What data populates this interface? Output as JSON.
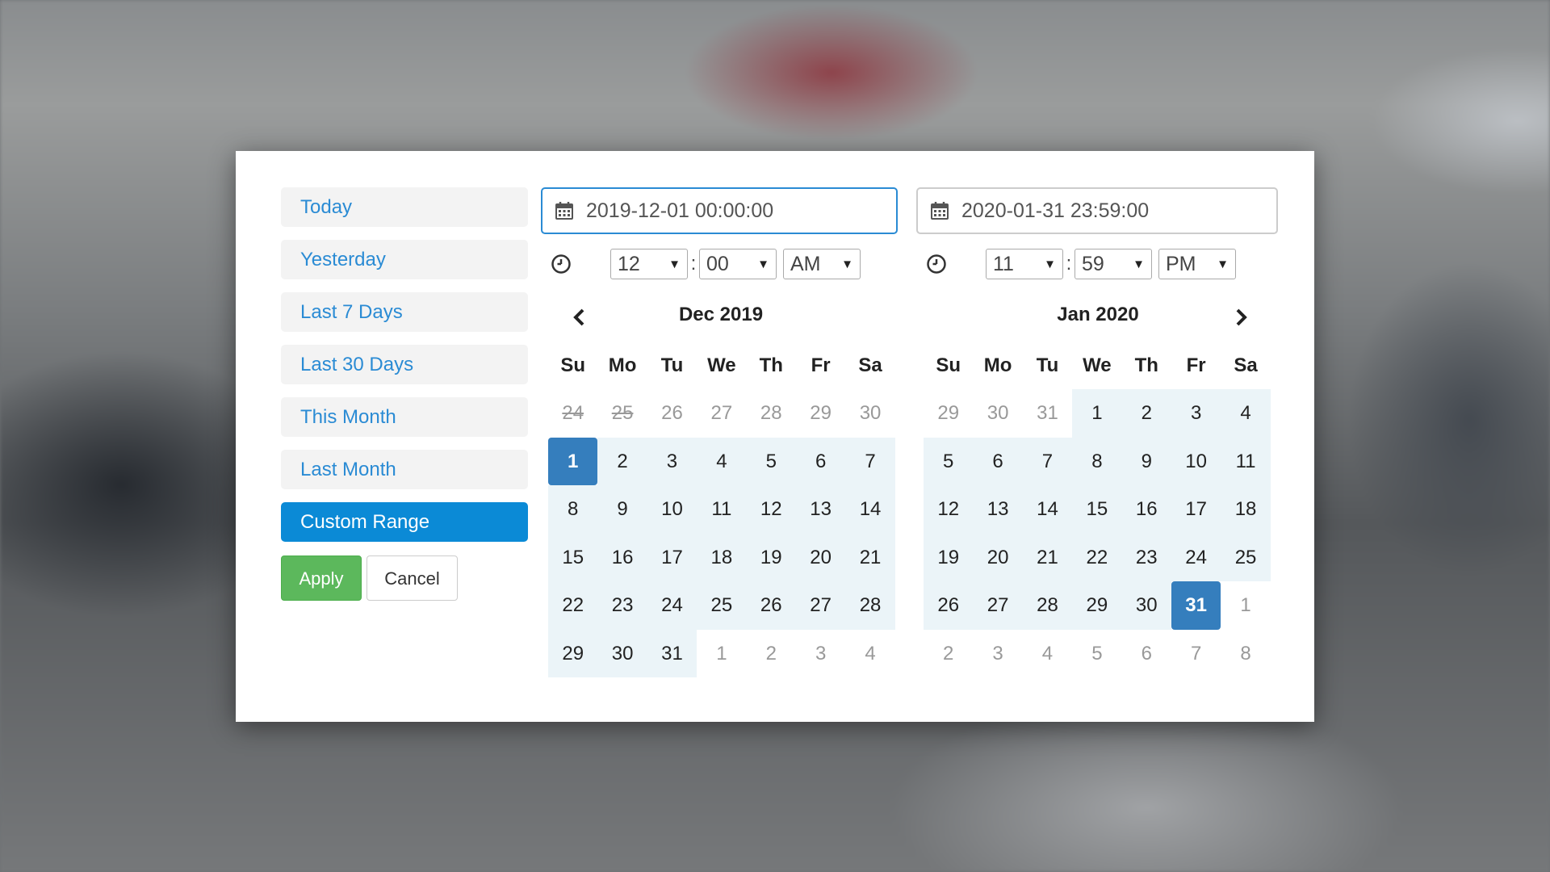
{
  "ranges": [
    {
      "label": "Today",
      "active": false
    },
    {
      "label": "Yesterday",
      "active": false
    },
    {
      "label": "Last 7 Days",
      "active": false
    },
    {
      "label": "Last 30 Days",
      "active": false
    },
    {
      "label": "This Month",
      "active": false
    },
    {
      "label": "Last Month",
      "active": false
    },
    {
      "label": "Custom Range",
      "active": true
    }
  ],
  "buttons": {
    "apply_label": "Apply",
    "cancel_label": "Cancel"
  },
  "icons": {
    "date_input": "calendar-icon",
    "time_row": "clock-icon",
    "prev": "chevron-left-icon",
    "next": "chevron-right-icon"
  },
  "colors": {
    "accent": "#0b8ad6",
    "selected_day": "#357ebd",
    "in_range": "#ebf4f8",
    "apply": "#5cb85c",
    "range_text": "#2a8bd4"
  },
  "weekdays": [
    "Su",
    "Mo",
    "Tu",
    "We",
    "Th",
    "Fr",
    "Sa"
  ],
  "left": {
    "date_value": "2019-12-01 00:00:00",
    "hour": "12",
    "minute": "00",
    "ampm": "AM",
    "month_title": "Dec 2019",
    "days": [
      {
        "d": "24",
        "s": "off strike"
      },
      {
        "d": "25",
        "s": "off strike"
      },
      {
        "d": "26",
        "s": "off"
      },
      {
        "d": "27",
        "s": "off"
      },
      {
        "d": "28",
        "s": "off"
      },
      {
        "d": "29",
        "s": "off"
      },
      {
        "d": "30",
        "s": "off"
      },
      {
        "d": "1",
        "s": "sel-day"
      },
      {
        "d": "2",
        "s": "in"
      },
      {
        "d": "3",
        "s": "in"
      },
      {
        "d": "4",
        "s": "in"
      },
      {
        "d": "5",
        "s": "in"
      },
      {
        "d": "6",
        "s": "in"
      },
      {
        "d": "7",
        "s": "in"
      },
      {
        "d": "8",
        "s": "in"
      },
      {
        "d": "9",
        "s": "in"
      },
      {
        "d": "10",
        "s": "in"
      },
      {
        "d": "11",
        "s": "in"
      },
      {
        "d": "12",
        "s": "in"
      },
      {
        "d": "13",
        "s": "in"
      },
      {
        "d": "14",
        "s": "in"
      },
      {
        "d": "15",
        "s": "in"
      },
      {
        "d": "16",
        "s": "in"
      },
      {
        "d": "17",
        "s": "in"
      },
      {
        "d": "18",
        "s": "in"
      },
      {
        "d": "19",
        "s": "in"
      },
      {
        "d": "20",
        "s": "in"
      },
      {
        "d": "21",
        "s": "in"
      },
      {
        "d": "22",
        "s": "in"
      },
      {
        "d": "23",
        "s": "in"
      },
      {
        "d": "24",
        "s": "in"
      },
      {
        "d": "25",
        "s": "in"
      },
      {
        "d": "26",
        "s": "in"
      },
      {
        "d": "27",
        "s": "in"
      },
      {
        "d": "28",
        "s": "in"
      },
      {
        "d": "29",
        "s": "in"
      },
      {
        "d": "30",
        "s": "in"
      },
      {
        "d": "31",
        "s": "in"
      },
      {
        "d": "1",
        "s": "off"
      },
      {
        "d": "2",
        "s": "off"
      },
      {
        "d": "3",
        "s": "off"
      },
      {
        "d": "4",
        "s": "off"
      }
    ]
  },
  "right": {
    "date_value": "2020-01-31 23:59:00",
    "hour": "11",
    "minute": "59",
    "ampm": "PM",
    "month_title": "Jan 2020",
    "days": [
      {
        "d": "29",
        "s": "off"
      },
      {
        "d": "30",
        "s": "off"
      },
      {
        "d": "31",
        "s": "off"
      },
      {
        "d": "1",
        "s": "in"
      },
      {
        "d": "2",
        "s": "in"
      },
      {
        "d": "3",
        "s": "in"
      },
      {
        "d": "4",
        "s": "in"
      },
      {
        "d": "5",
        "s": "in"
      },
      {
        "d": "6",
        "s": "in"
      },
      {
        "d": "7",
        "s": "in"
      },
      {
        "d": "8",
        "s": "in"
      },
      {
        "d": "9",
        "s": "in"
      },
      {
        "d": "10",
        "s": "in"
      },
      {
        "d": "11",
        "s": "in"
      },
      {
        "d": "12",
        "s": "in"
      },
      {
        "d": "13",
        "s": "in"
      },
      {
        "d": "14",
        "s": "in"
      },
      {
        "d": "15",
        "s": "in"
      },
      {
        "d": "16",
        "s": "in"
      },
      {
        "d": "17",
        "s": "in"
      },
      {
        "d": "18",
        "s": "in"
      },
      {
        "d": "19",
        "s": "in"
      },
      {
        "d": "20",
        "s": "in"
      },
      {
        "d": "21",
        "s": "in"
      },
      {
        "d": "22",
        "s": "in"
      },
      {
        "d": "23",
        "s": "in"
      },
      {
        "d": "24",
        "s": "in"
      },
      {
        "d": "25",
        "s": "in"
      },
      {
        "d": "26",
        "s": "in"
      },
      {
        "d": "27",
        "s": "in"
      },
      {
        "d": "28",
        "s": "in"
      },
      {
        "d": "29",
        "s": "in"
      },
      {
        "d": "30",
        "s": "in"
      },
      {
        "d": "31",
        "s": "sel-day"
      },
      {
        "d": "1",
        "s": "off"
      },
      {
        "d": "2",
        "s": "off"
      },
      {
        "d": "3",
        "s": "off"
      },
      {
        "d": "4",
        "s": "off"
      },
      {
        "d": "5",
        "s": "off"
      },
      {
        "d": "6",
        "s": "off"
      },
      {
        "d": "7",
        "s": "off"
      },
      {
        "d": "8",
        "s": "off"
      }
    ]
  }
}
